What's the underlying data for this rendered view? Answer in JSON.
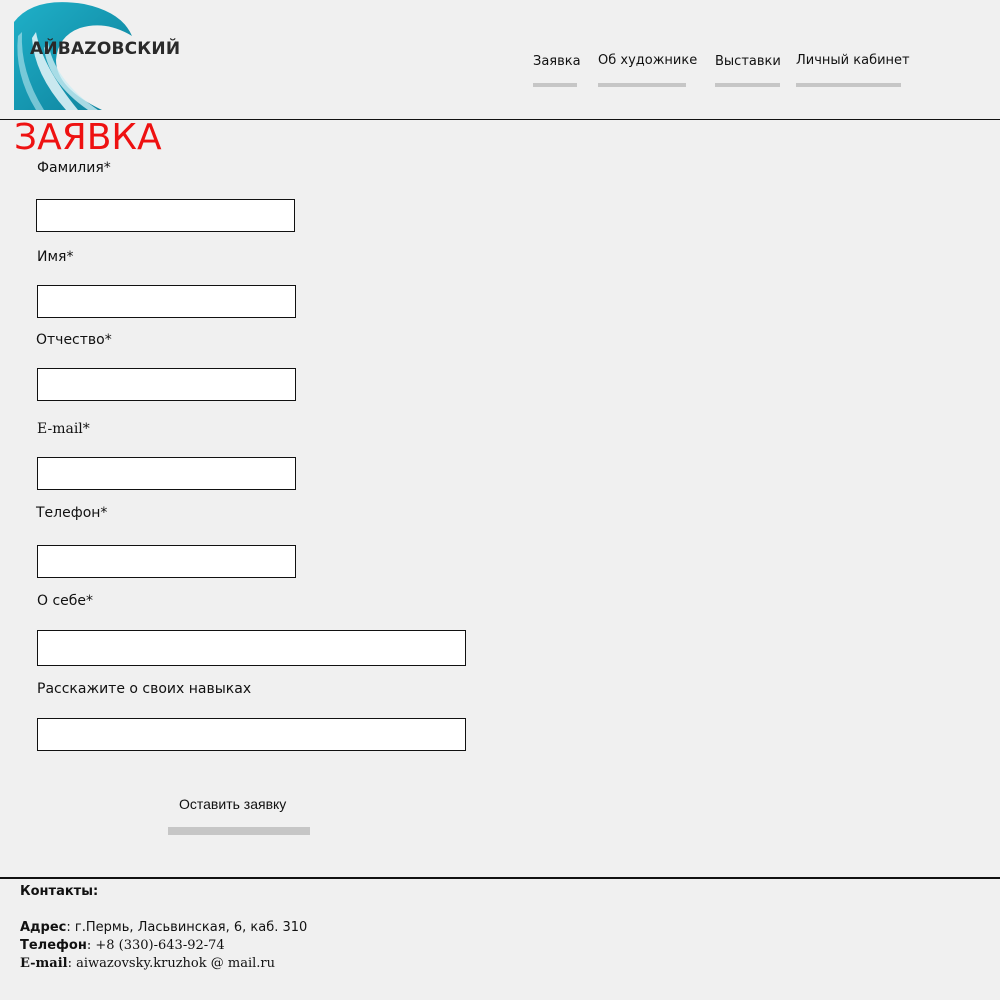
{
  "logo": {
    "text": "АЙВАZОВСКИЙ"
  },
  "nav": {
    "items": [
      {
        "label": "Заявка"
      },
      {
        "label": "Об художнике"
      },
      {
        "label": "Выставки"
      },
      {
        "label": "Личный кабинет"
      }
    ]
  },
  "page": {
    "title": "ЗАЯВКА"
  },
  "form": {
    "fields": [
      {
        "label": "Фамилия*",
        "value": ""
      },
      {
        "label": "Имя*",
        "value": ""
      },
      {
        "label": "Отчество*",
        "value": ""
      },
      {
        "label": "E-mail*",
        "value": ""
      },
      {
        "label": "Телефон*",
        "value": ""
      },
      {
        "label": "О себе*",
        "value": ""
      },
      {
        "label": "Расскажите о своих навыках",
        "value": ""
      }
    ],
    "submit_label": "Оставить заявку"
  },
  "footer": {
    "heading": "Контакты:",
    "address_label": "Адрес",
    "address_value": ": г.Пермь, Ласьвинская, 6, каб. 310",
    "phone_label": "Телефон",
    "phone_value": ": +8 (330)-643-92-74",
    "email_label": "E-mail",
    "email_value": ": aiwazovsky.kruzhok @ mail.ru"
  },
  "colors": {
    "accent_title": "#ee1111",
    "wave": "#1aa3b8",
    "nav_underline": "#c6c6c6",
    "background": "#f0f0f0"
  }
}
